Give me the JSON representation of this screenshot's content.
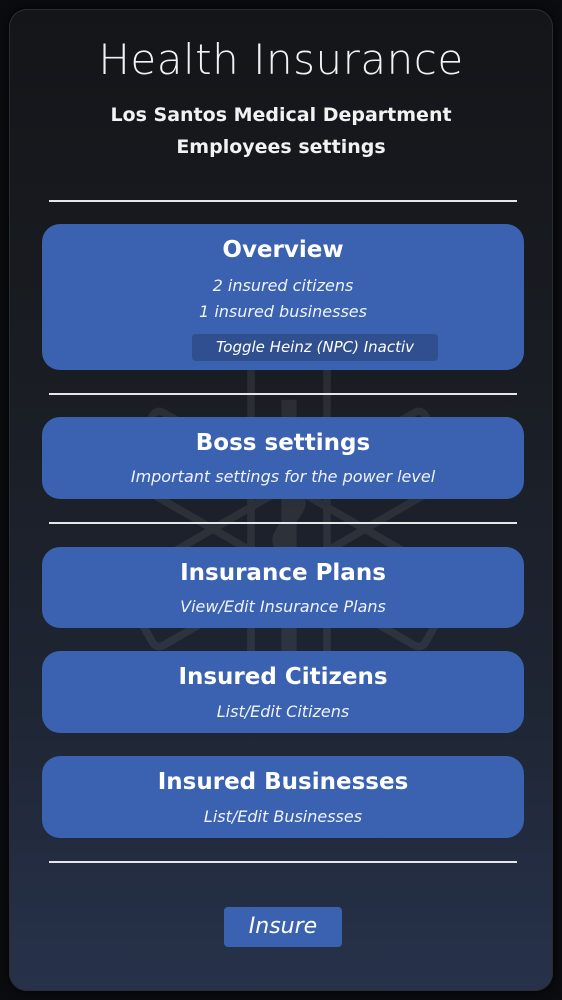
{
  "header": {
    "title": "Health Insurance",
    "subtitle": "Los Santos Medical Department",
    "section": "Employees settings"
  },
  "overview": {
    "title": "Overview",
    "insured_citizens": "2 insured citizens",
    "insured_businesses": "1 insured businesses",
    "toggle_label": "Toggle Heinz (NPC) Inactiv"
  },
  "boss_settings": {
    "title": "Boss settings",
    "description": "Important settings for the power level"
  },
  "insurance_plans": {
    "title": "Insurance Plans",
    "description": "View/Edit Insurance Plans"
  },
  "insured_citizens": {
    "title": "Insured Citizens",
    "description": "List/Edit Citizens"
  },
  "insured_businesses": {
    "title": "Insured Businesses",
    "description": "List/Edit Businesses"
  },
  "footer": {
    "insure_label": "Insure"
  },
  "colors": {
    "card": "#3a62b0",
    "toggle": "#2f4f8e",
    "divider": "#e6e6e6",
    "background": "#1a1d24"
  },
  "icons": {
    "watermark": "star-of-life-icon"
  }
}
